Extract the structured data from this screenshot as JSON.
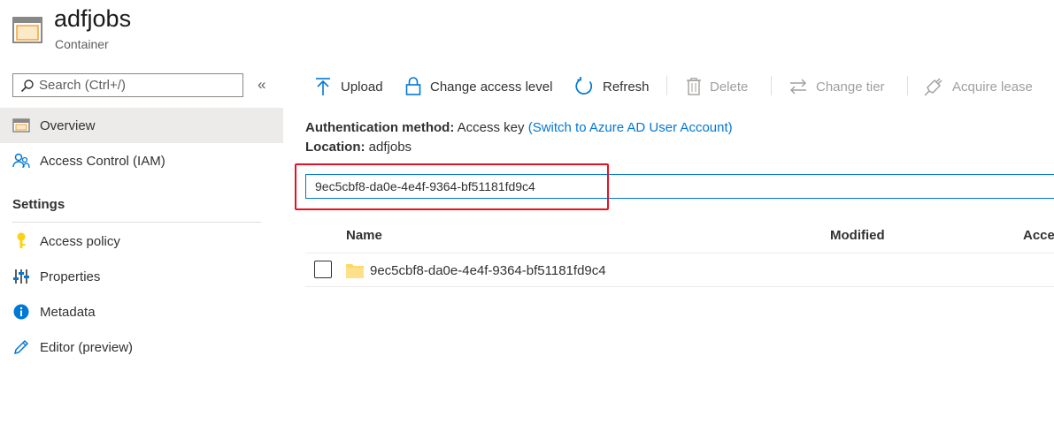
{
  "header": {
    "title": "adfjobs",
    "subtitle": "Container",
    "icon": "container-icon"
  },
  "sidebar": {
    "search_placeholder": "Search (Ctrl+/)",
    "collapse_label": "«",
    "items": [
      {
        "label": "Overview",
        "icon": "overview-icon",
        "active": true
      },
      {
        "label": "Access Control (IAM)",
        "icon": "people-icon",
        "active": false
      }
    ],
    "settings_heading": "Settings",
    "settings_items": [
      {
        "label": "Access policy",
        "icon": "key-icon"
      },
      {
        "label": "Properties",
        "icon": "sliders-icon"
      },
      {
        "label": "Metadata",
        "icon": "info-icon"
      },
      {
        "label": "Editor (preview)",
        "icon": "pencil-icon"
      }
    ]
  },
  "toolbar": {
    "upload": "Upload",
    "change_access": "Change access level",
    "refresh": "Refresh",
    "delete": "Delete",
    "change_tier": "Change tier",
    "acquire_lease": "Acquire lease"
  },
  "info": {
    "auth_label": "Authentication method:",
    "auth_value": "Access key",
    "auth_link": "(Switch to Azure AD User Account)",
    "location_label": "Location:",
    "location_value": "adfjobs"
  },
  "path_input_value": "9ec5cbf8-da0e-4e4f-9364-bf51181fd9c4",
  "table": {
    "columns": [
      "Name",
      "Modified",
      "Acce"
    ],
    "rows": [
      {
        "name": "9ec5cbf8-da0e-4e4f-9364-bf51181fd9c4",
        "type": "folder"
      }
    ]
  },
  "colors": {
    "accent": "#0078d4",
    "highlight": "#e81123",
    "folder": "#ffd966"
  }
}
